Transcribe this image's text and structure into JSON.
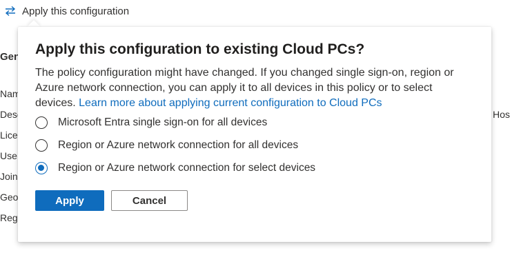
{
  "toolbar": {
    "apply_config_label": "Apply this configuration",
    "apply_config_icon": "swap-arrows-icon"
  },
  "background": {
    "section_heading": "Gen",
    "row_labels": [
      "Nam",
      "Desc",
      "Licen",
      "Use",
      "Join",
      "Geo",
      "Regi"
    ],
    "right_label": "Hos"
  },
  "callout": {
    "title": "Apply this configuration to existing Cloud PCs?",
    "body": "The policy configuration might have changed. If you changed single sign-on, region or Azure network connection, you can apply it to all devices in this policy or to select devices.",
    "link_text": "Learn more about applying current configuration to Cloud PCs",
    "options": [
      {
        "label": "Microsoft Entra single sign-on for all devices",
        "checked": false
      },
      {
        "label": "Region or Azure network connection for all devices",
        "checked": false
      },
      {
        "label": "Region or Azure network connection for select devices",
        "checked": true
      }
    ],
    "apply_label": "Apply",
    "cancel_label": "Cancel"
  },
  "colors": {
    "accent": "#0f6cbd",
    "text": "#323130",
    "title": "#201f1e"
  }
}
